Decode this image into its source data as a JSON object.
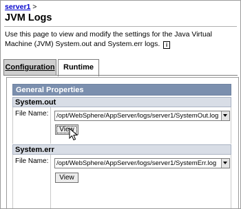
{
  "breadcrumb": {
    "link": "server1",
    "separator": ">"
  },
  "page": {
    "title": "JVM Logs",
    "description": "Use this page to view and modify the settings for the Java Virtual Machine (JVM) System.out and System.err logs.",
    "info_icon": "info-icon"
  },
  "tabs": [
    {
      "label": "Configuration",
      "active": false
    },
    {
      "label": "Runtime",
      "active": true
    }
  ],
  "general_properties": {
    "title": "General Properties"
  },
  "system_out": {
    "title": "System.out",
    "file_label": "File Name:",
    "file_value": "/opt/WebSphere/AppServer/logs/server1/SystemOut.log",
    "view_button": "View"
  },
  "system_err": {
    "title": "System.err",
    "file_label": "File Name:",
    "file_value": "/opt/WebSphere/AppServer/logs/server1/SystemErr.log",
    "view_button": "View"
  },
  "colors": {
    "link": "#0000cc",
    "section_header": "#7b8fae",
    "subsection_header": "#d8dde6"
  }
}
